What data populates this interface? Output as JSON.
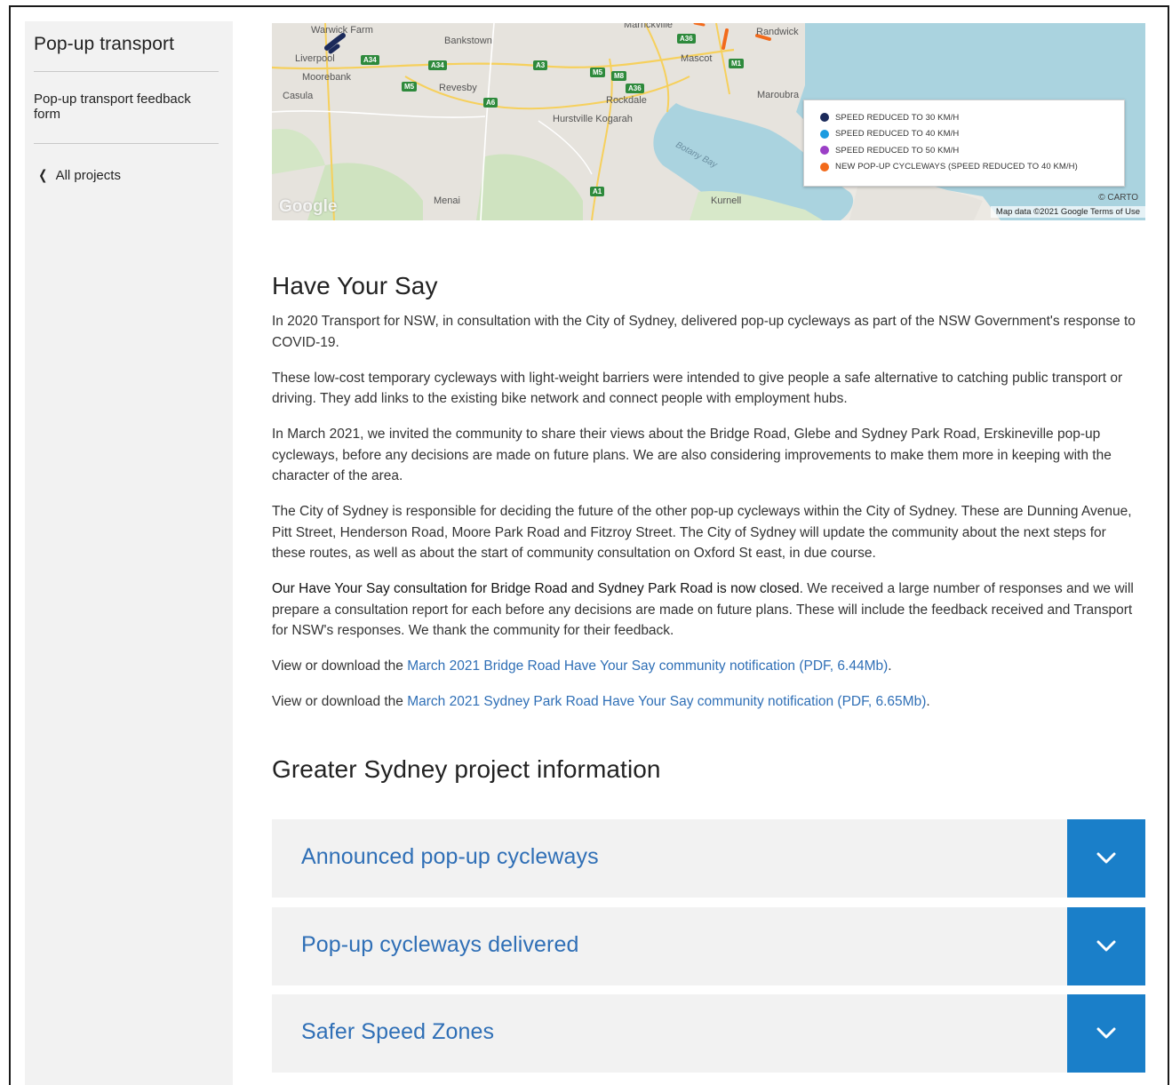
{
  "sidebar": {
    "title": "Pop-up transport",
    "link": "Pop-up transport feedback form",
    "back": "All projects"
  },
  "map": {
    "legend": [
      {
        "label": "SPEED REDUCED TO 30 KM/H",
        "color": "#1b2a5a"
      },
      {
        "label": "SPEED REDUCED TO 40 KM/H",
        "color": "#1a9be0"
      },
      {
        "label": "SPEED REDUCED TO 50 KM/H",
        "color": "#9b3fc6"
      },
      {
        "label": "NEW POP-UP CYCLEWAYS (SPEED REDUCED TO 40 KM/H)",
        "color": "#f26a1b"
      }
    ],
    "places": {
      "warwick_farm": "Warwick Farm",
      "bankstown": "Bankstown",
      "marrickville": "Marrickville",
      "randwick": "Randwick",
      "liverpool": "Liverpool",
      "moorebank": "Moorebank",
      "casula": "Casula",
      "revesby": "Revesby",
      "mascot": "Mascot",
      "rockdale": "Rockdale",
      "maroubra": "Maroubra",
      "hurstville_kogarah": "Hurstville Kogarah",
      "botany_bay": "Botany Bay",
      "menai": "Menai",
      "kurnell": "Kurnell"
    },
    "roads": {
      "a34": "A34",
      "a3": "A3",
      "m5": "M5",
      "m8": "M8",
      "a36": "A36",
      "m1": "M1",
      "a6": "A6",
      "a1": "A1"
    },
    "google": "Google",
    "carto": "© CARTO",
    "attribution": "Map data ©2021 Google   Terms of Use"
  },
  "have_your_say": {
    "heading": "Have Your Say",
    "p1": "In 2020 Transport for NSW, in consultation with the City of Sydney, delivered pop-up cycleways as part of the NSW Government's response to COVID-19.",
    "p2": "These low-cost temporary cycleways with light-weight barriers were intended to give people a safe alternative to catching public transport or driving. They add links to the existing bike network and connect people with employment hubs.",
    "p3": "In March 2021, we invited the community to share their views about the Bridge Road, Glebe and Sydney Park Road, Erskineville pop-up cycleways, before any decisions are made on future plans. We are also considering improvements to make them more in keeping with the character of the area.",
    "p4": "The City of Sydney is responsible for deciding the future of the other pop-up cycleways within the City of Sydney. These are Dunning Avenue, Pitt Street, Henderson Road, Moore Park Road and Fitzroy Street. The City of Sydney will update the community about the next steps for these routes, as well as about the start of community consultation on Oxford St east, in due course.",
    "p5_bold": "Our Have Your Say consultation for Bridge Road and Sydney Park Road is now closed",
    "p5_rest": ". We received a large number of responses and we will prepare a consultation report for each before any decisions are made on future plans. These will include the feedback received and Transport for NSW's responses. We thank the community for their feedback.",
    "download_prefix": "View or download the ",
    "link1": "March 2021 Bridge Road Have Your Say community notification (PDF, 6.44Mb)",
    "link2": "March 2021 Sydney Park Road Have Your Say community notification (PDF, 6.65Mb)",
    "period": "."
  },
  "project_info": {
    "heading": "Greater Sydney project information",
    "items": [
      {
        "label": "Announced pop-up cycleways"
      },
      {
        "label": "Pop-up cycleways delivered"
      },
      {
        "label": "Safer Speed Zones"
      }
    ]
  }
}
